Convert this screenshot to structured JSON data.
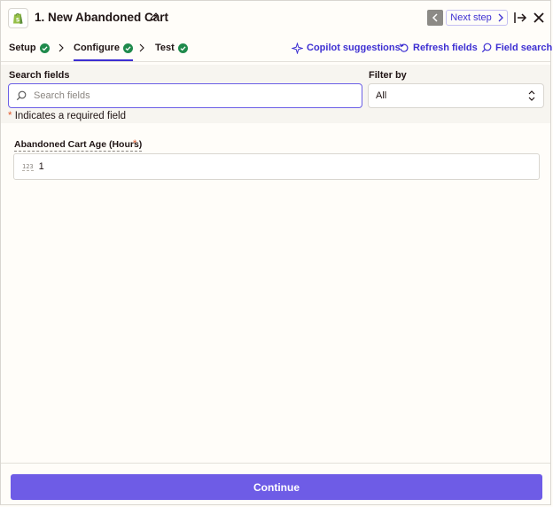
{
  "header": {
    "title": "1. New Abandoned Cart",
    "next_step_label": "Next step"
  },
  "steps": [
    {
      "label": "Setup"
    },
    {
      "label": "Configure"
    },
    {
      "label": "Test"
    }
  ],
  "tools": {
    "copilot": "Copilot suggestions",
    "refresh": "Refresh fields",
    "field_search": "Field search"
  },
  "filters": {
    "search_label": "Search fields",
    "search_placeholder": "Search fields",
    "filter_label": "Filter by",
    "filter_value": "All",
    "required_note": "Indicates a required field"
  },
  "field": {
    "label": "Abandoned Cart Age (Hours)",
    "type_icon": "123",
    "value": "1"
  },
  "footer": {
    "continue_label": "Continue"
  },
  "colors": {
    "accent": "#3d2fd2",
    "button": "#6e5ce6",
    "check": "#1f8a4c",
    "required": "#e35a2c"
  }
}
